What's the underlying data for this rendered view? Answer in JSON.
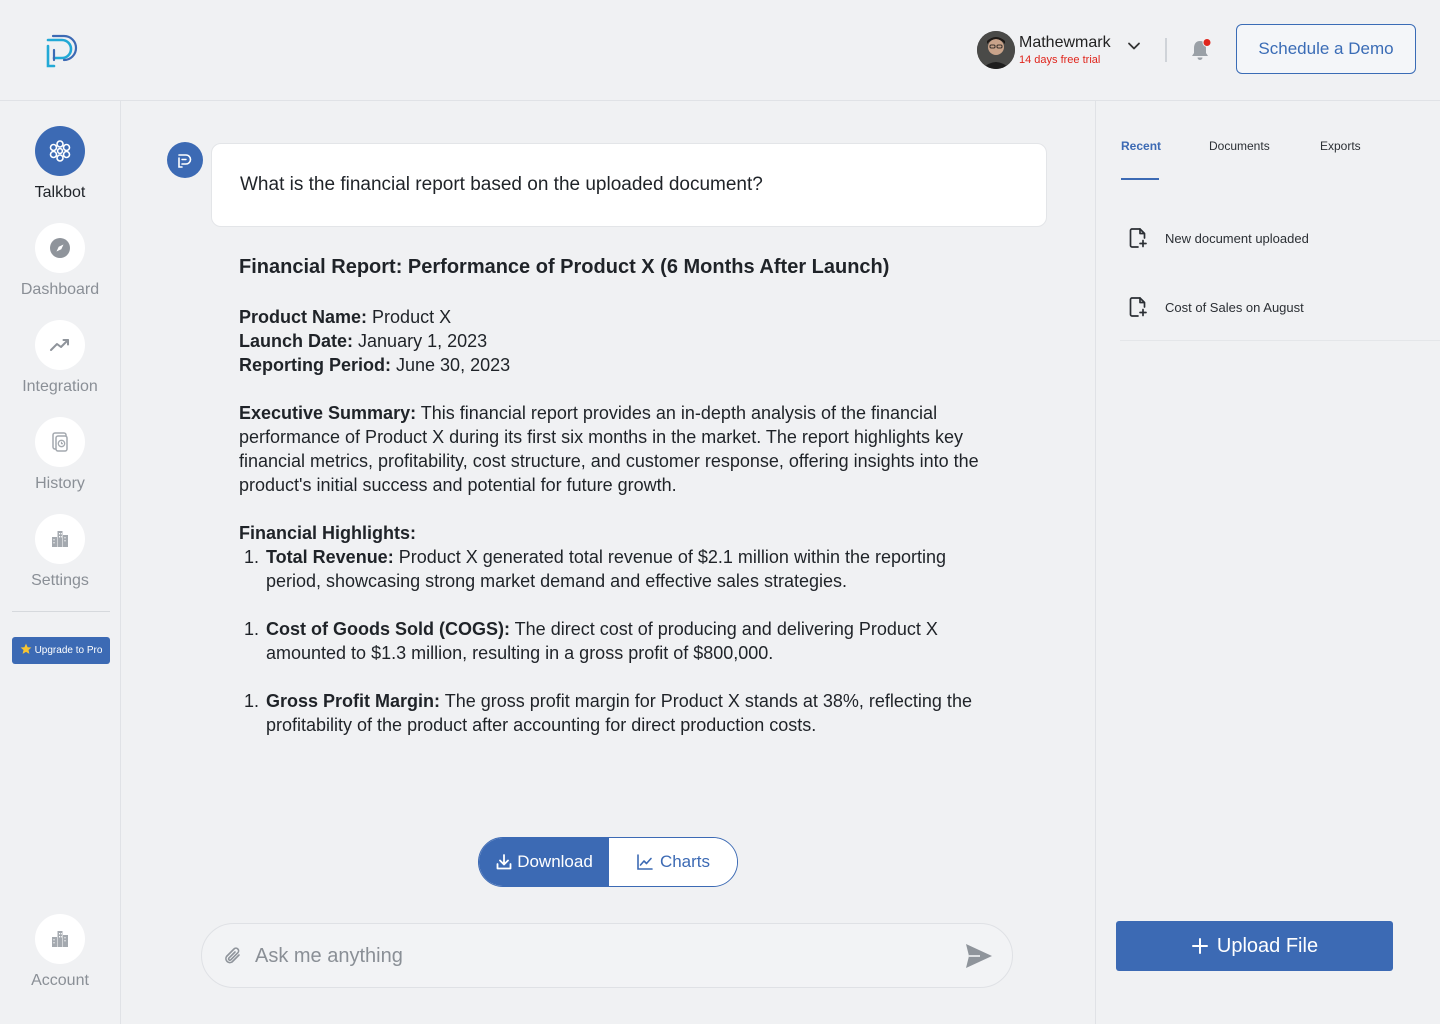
{
  "header": {
    "user_name": "Mathewmark",
    "user_trial": "14 days free trial",
    "schedule_label": "Schedule a Demo"
  },
  "sidebar": {
    "items": [
      {
        "label": "Talkbot",
        "icon": "talkbot-icon",
        "active": true
      },
      {
        "label": "Dashboard",
        "icon": "compass-icon"
      },
      {
        "label": "Integration",
        "icon": "trend-icon"
      },
      {
        "label": "History",
        "icon": "history-icon"
      },
      {
        "label": "Settings",
        "icon": "buildings-icon"
      }
    ],
    "upgrade_label": "Upgrade to Pro",
    "account_label": "Account"
  },
  "chat": {
    "question": "What is the financial report based on the uploaded document?",
    "answer": {
      "title": "Financial Report: Performance of Product X (6 Months After Launch)",
      "product_name_label": "Product Name:",
      "product_name": "Product X",
      "launch_date_label": "Launch Date:",
      "launch_date": "January 1, 2023",
      "reporting_period_label": "Reporting Period:",
      "reporting_period": "June 30, 2023",
      "summary_label": "Executive Summary:",
      "summary": "This financial report provides an in-depth analysis of the financial performance of Product X during its first six months in the market. The report highlights key financial metrics, profitability, cost structure, and customer response, offering insights into the product's initial success and potential for future growth.",
      "highlights_label": "Financial Highlights:",
      "highlights": [
        {
          "num": "1.",
          "label": "Total Revenue:",
          "text": "Product X generated total revenue of $2.1 million within the reporting period, showcasing strong market demand and effective sales strategies."
        },
        {
          "num": "1.",
          "label": "Cost of Goods Sold (COGS):",
          "text": "The direct cost of producing and delivering Product X amounted to $1.3 million, resulting in a gross profit of $800,000."
        },
        {
          "num": "1.",
          "label": "Gross Profit Margin:",
          "text": "The gross profit margin for Product X stands at 38%, reflecting the profitability of the product after accounting for direct production costs."
        }
      ]
    },
    "download_label": "Download",
    "charts_label": "Charts",
    "input_placeholder": "Ask me anything"
  },
  "right_panel": {
    "tabs": [
      "Recent",
      "Documents",
      "Exports"
    ],
    "active_tab": "Recent",
    "recent": [
      "New document uploaded",
      "Cost of Sales on August"
    ],
    "upload_label": "Upload File"
  },
  "colors": {
    "accent": "#3c6ab4",
    "trial": "#e0251c",
    "notification_dot": "#e0251c"
  }
}
